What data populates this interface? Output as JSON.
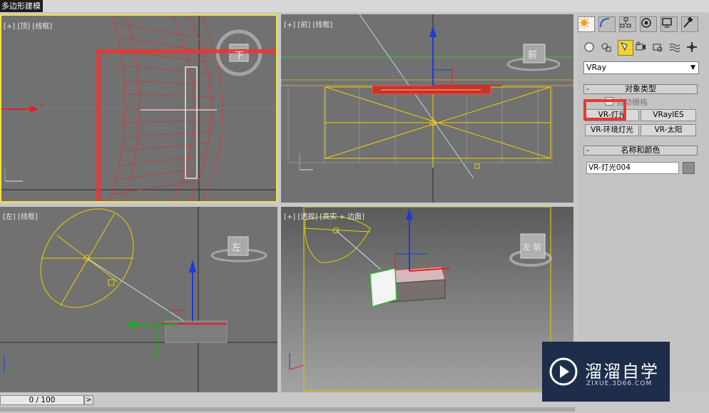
{
  "window": {
    "title": "多边形建模"
  },
  "viewports": {
    "top": {
      "label": "[+] [顶] [线框]",
      "cube_label": "下"
    },
    "front": {
      "label": "[+] [前] [线框]",
      "cube_label": "前"
    },
    "left": {
      "label": "[左] [线框]",
      "cube_label": "左"
    },
    "perspective": {
      "label": "[+] [透视] [真实 + 边面]",
      "cube_label": "左 前"
    }
  },
  "command_panel": {
    "tabs": [
      "create-icon",
      "modify-icon",
      "hierarchy-icon",
      "motion-icon",
      "display-icon",
      "utilities-icon"
    ],
    "subcategories": [
      "geometry-icon",
      "shapes-icon",
      "lights-icon",
      "cameras-icon",
      "helpers-icon",
      "spacewarps-icon",
      "systems-icon"
    ],
    "renderer_dropdown": "VRay",
    "object_type": {
      "header": "对象类型",
      "autogrid": "自动栅格",
      "buttons": [
        "VR-灯光",
        "VRayIES",
        "VR-环境灯光",
        "VR-太阳"
      ]
    },
    "name_and_color": {
      "header": "名称和颜色",
      "name_value": "VR-灯光004",
      "color": "#8c8c8c"
    }
  },
  "timeline": {
    "frame": "0 / 100",
    "next": ">"
  },
  "watermark": {
    "title": "溜溜自学",
    "url": "ZIXUE.3D66.COM"
  },
  "colors": {
    "highlight": "#e53935",
    "active_border": "#f3e24b",
    "selection": "#e8d200"
  }
}
